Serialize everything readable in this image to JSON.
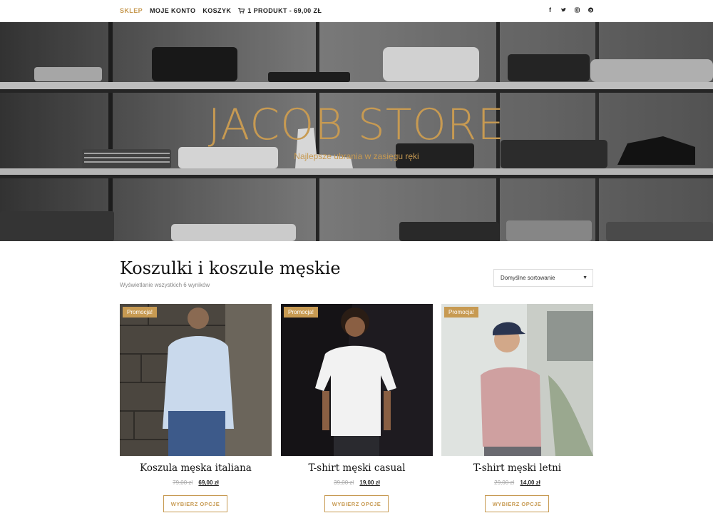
{
  "nav": {
    "items": [
      {
        "label": "SKLEP",
        "active": true
      },
      {
        "label": "MOJE KONTO",
        "active": false
      },
      {
        "label": "KOSZYK",
        "active": false
      }
    ],
    "cart_label": "1 PRODUKT - 69,00 ZŁ",
    "social": [
      "facebook-icon",
      "twitter-icon",
      "instagram-icon",
      "pinterest-icon"
    ]
  },
  "hero": {
    "title": "JACOB STORE",
    "subtitle": "Najlepsze ubrania w zasięgu ręki"
  },
  "main": {
    "title": "Koszulki i koszule męskie",
    "result_count": "Wyświetlanie wszystkich 6 wyników",
    "sort_label": "Domyślne sortowanie"
  },
  "products": [
    {
      "badge": "Promocja!",
      "name": "Koszula męska italiana",
      "old_price": "79,00 zł",
      "new_price": "69,00 zł",
      "button": "WYBIERZ OPCJE"
    },
    {
      "badge": "Promocja!",
      "name": "T-shirt męski casual",
      "old_price": "39,00 zł",
      "new_price": "19,00 zł",
      "button": "WYBIERZ OPCJE"
    },
    {
      "badge": "Promocja!",
      "name": "T-shirt męski letni",
      "old_price": "29,00 zł",
      "new_price": "14,00 zł",
      "button": "WYBIERZ OPCJE"
    }
  ],
  "colors": {
    "accent": "#c79a52"
  }
}
